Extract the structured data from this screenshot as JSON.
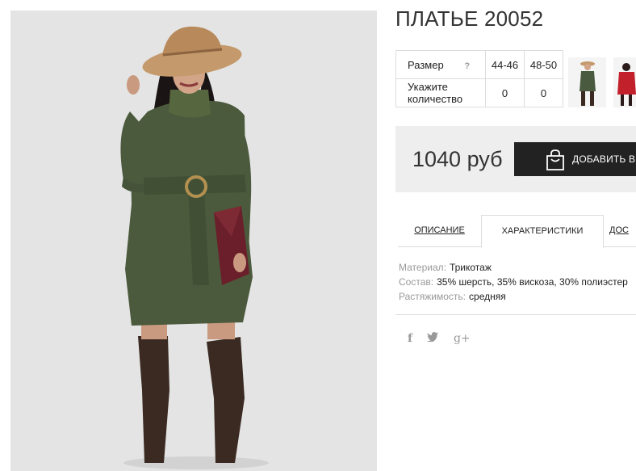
{
  "product": {
    "title": "ПЛАТЬЕ 20052",
    "image_alt": "model-in-green-dress"
  },
  "sizes": {
    "size_label": "Размер",
    "help_icon": "?",
    "options": [
      "44-46",
      "48-50"
    ],
    "quantity_label_line1": "Укажите",
    "quantity_label_line2": "количество",
    "quantities": [
      "0",
      "0"
    ]
  },
  "thumbnails": [
    {
      "name": "thumb-green-dress",
      "color": "#4a5a3e"
    },
    {
      "name": "thumb-red-coat",
      "color": "#c2202a"
    }
  ],
  "purchase": {
    "price": "1040 руб",
    "add_to_cart_label": "ДОБАВИТЬ В З",
    "bag_icon": "shopping-bag-icon"
  },
  "tabs": [
    {
      "label": "ОПИСАНИЕ",
      "active": false
    },
    {
      "label": "ХАРАКТЕРИСТИКИ",
      "active": true
    },
    {
      "label": "ДОС",
      "active": false
    }
  ],
  "characteristics": [
    {
      "key": "Материал:",
      "value": "Трикотаж"
    },
    {
      "key": "Состав:",
      "value": "35% шерсть, 35% вискоза, 30% полиэстер"
    },
    {
      "key": "Растяжимость:",
      "value": "средняя"
    }
  ],
  "social": {
    "facebook": "f",
    "twitter": "🐦",
    "googleplus": "g+"
  },
  "colors": {
    "price_box_bg": "#eeeeee",
    "button_bg": "#222222",
    "dress": "#4b5a3c",
    "hat": "#c49a6c",
    "boots": "#3a2a22"
  }
}
